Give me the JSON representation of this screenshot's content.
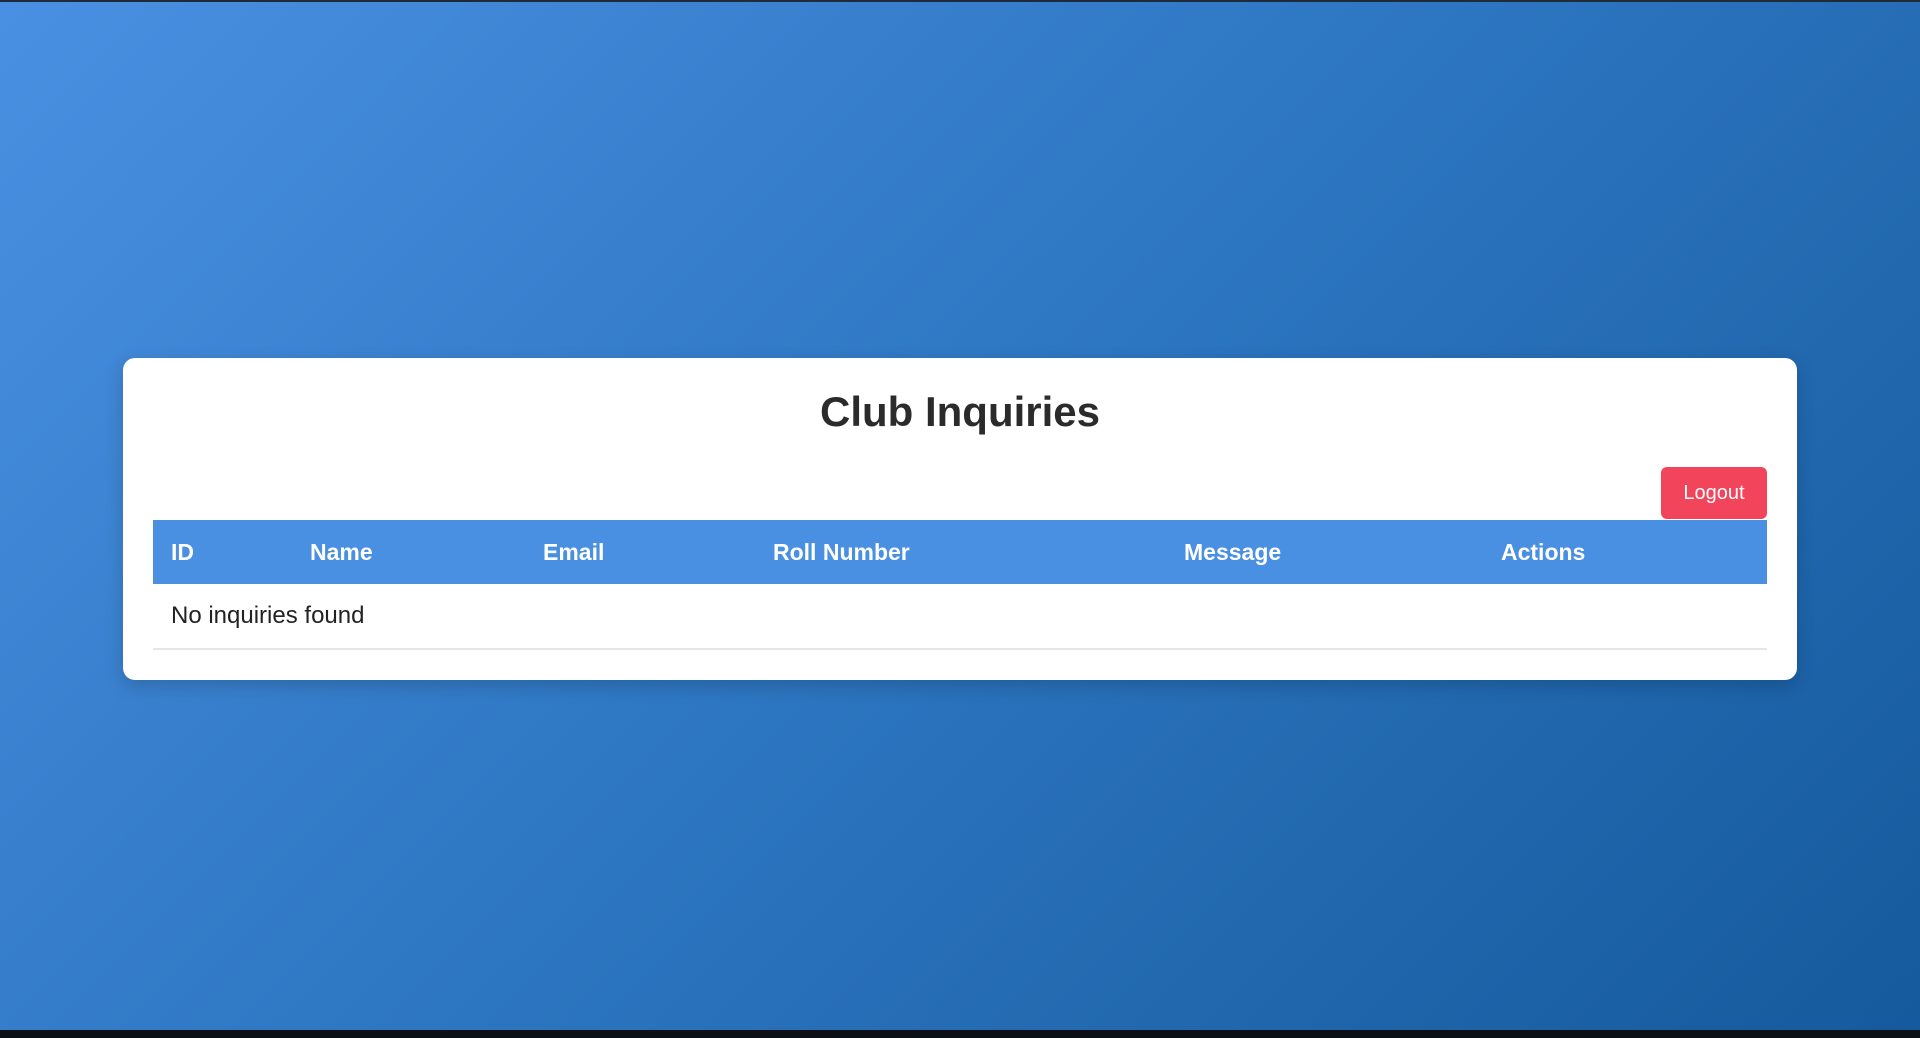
{
  "page": {
    "title": "Club Inquiries",
    "logout_label": "Logout"
  },
  "table": {
    "columns": [
      "ID",
      "Name",
      "Email",
      "Roll Number",
      "Message",
      "Actions"
    ],
    "empty_message": "No inquiries found"
  },
  "colors": {
    "header_bg": "#4a90e2",
    "logout_bg": "#f2445a",
    "background_start": "#4a90e2",
    "background_end": "#155a9c"
  }
}
